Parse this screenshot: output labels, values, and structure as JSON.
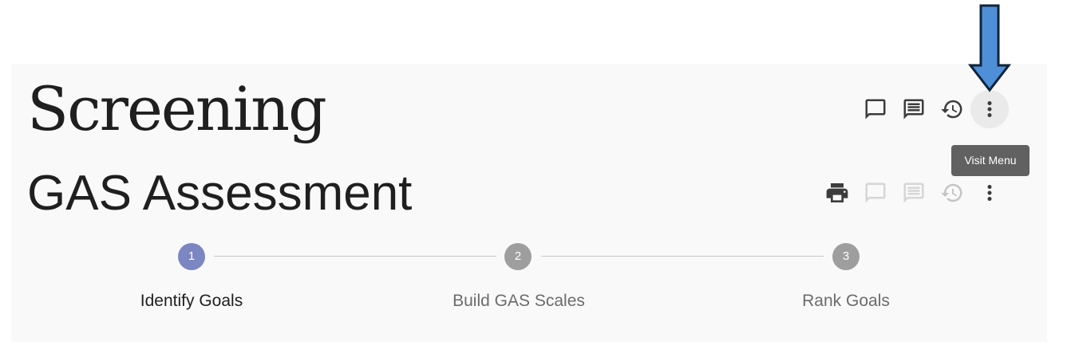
{
  "header": {
    "title": "Screening",
    "icons": [
      "comment-icon",
      "notes-icon",
      "history-icon",
      "more-vert-icon"
    ]
  },
  "tooltip": {
    "text": "Visit Menu"
  },
  "assessment": {
    "title": "GAS Assessment",
    "icons": [
      "print-icon",
      "comment-icon",
      "notes-icon",
      "history-icon",
      "more-vert-icon"
    ]
  },
  "stepper": {
    "steps": [
      {
        "number": "1",
        "label": "Identify Goals",
        "state": "active"
      },
      {
        "number": "2",
        "label": "Build GAS Scales",
        "state": "inactive"
      },
      {
        "number": "3",
        "label": "Rank Goals",
        "state": "inactive"
      }
    ]
  },
  "colors": {
    "active_step": "#7b86c2",
    "inactive_step": "#9e9e9e",
    "annotation_arrow": "#4f8fd8",
    "tooltip_bg": "#616161"
  }
}
